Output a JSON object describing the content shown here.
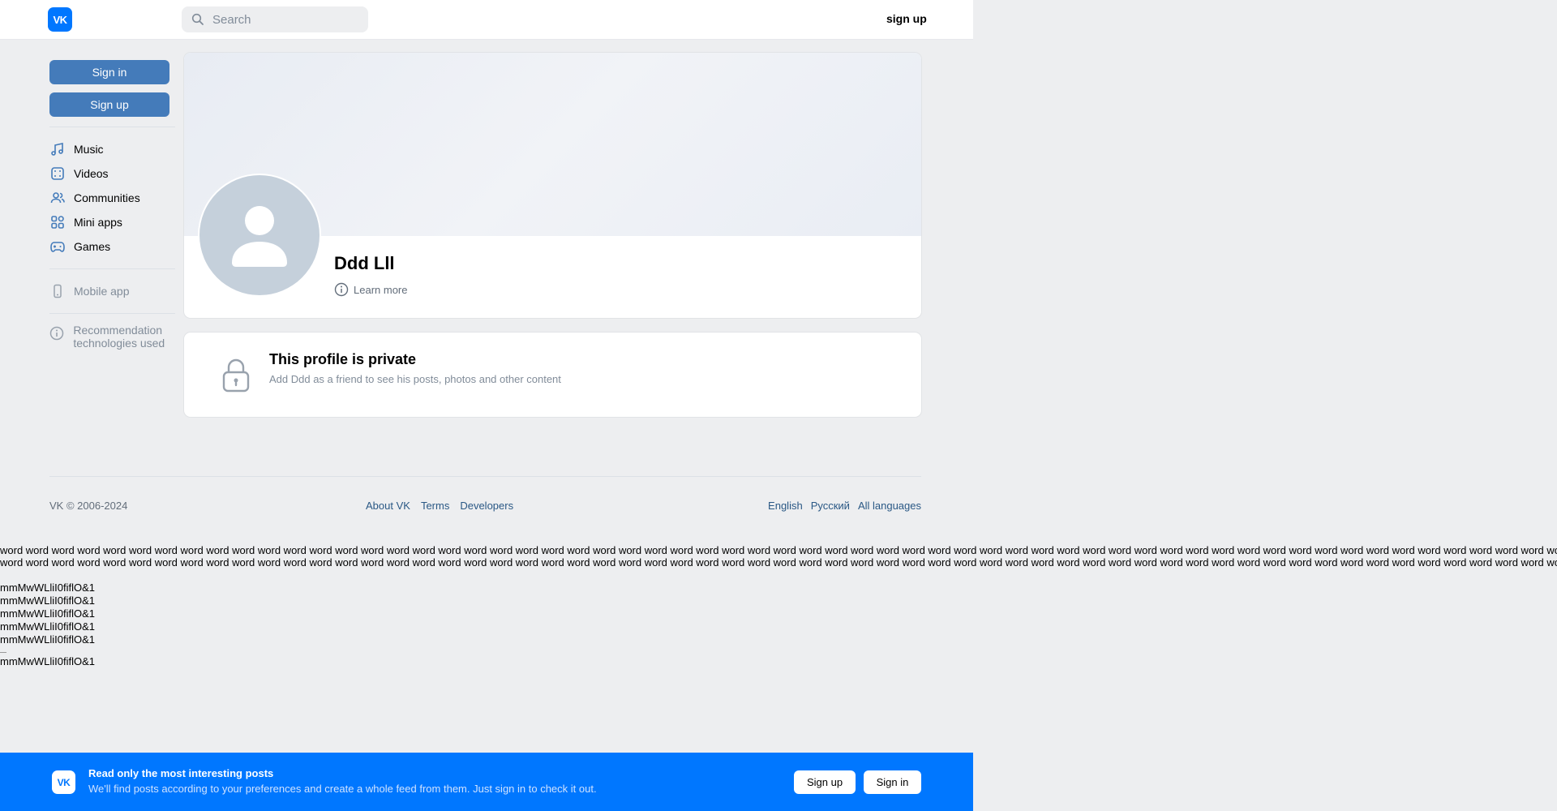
{
  "header": {
    "logo_text": "VK",
    "search_placeholder": "Search",
    "signup_label": "sign up"
  },
  "sidebar": {
    "signin_label": "Sign in",
    "signup_label": "Sign up",
    "items": [
      {
        "label": "Music",
        "icon": "music-note-icon"
      },
      {
        "label": "Videos",
        "icon": "video-icon"
      },
      {
        "label": "Communities",
        "icon": "users-icon"
      },
      {
        "label": "Mini apps",
        "icon": "grid-icon"
      },
      {
        "label": "Games",
        "icon": "gamepad-icon"
      }
    ],
    "mobile_app_label": "Mobile app",
    "recommendation_label": "Recommendation technologies used"
  },
  "profile": {
    "name": "Ddd Lll",
    "learn_more_label": "Learn more"
  },
  "private_notice": {
    "title": "This profile is private",
    "subtitle": "Add Ddd as a friend to see his posts, photos and other content"
  },
  "footer": {
    "copyright": "VK © 2006-2024",
    "links": [
      "About VK",
      "Terms",
      "Developers"
    ],
    "languages": [
      "English",
      "Русский",
      "All languages"
    ]
  },
  "test_text": {
    "words_line": "word word word word word word word word word word word word word word word word word word word word word word word word word word word word word word word word word word word word word word word word word word word word word word word word word word word word word word word word word word word word word word word word word word word word",
    "glyph_line": "mmMwWLliI0fiflO&1"
  },
  "banner": {
    "logo_text": "VK",
    "title": "Read only the most interesting posts",
    "subtitle": "We'll find posts according to your preferences and create a whole feed from them. Just sign in to check it out.",
    "signup_label": "Sign up",
    "signin_label": "Sign in"
  },
  "colors": {
    "brand": "#0077ff",
    "button_blue": "#447bba",
    "page_bg": "#edeef0",
    "link": "#2a5885"
  }
}
